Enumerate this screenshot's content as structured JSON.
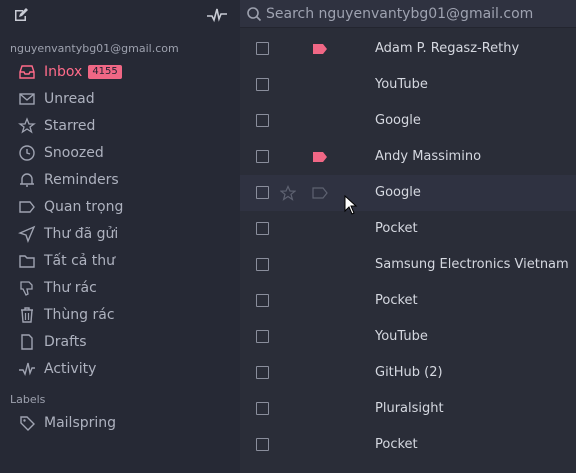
{
  "toolbar": {
    "compose_icon": "compose-icon",
    "activity_icon": "activity-icon"
  },
  "search": {
    "placeholder": "Search nguyenvantybg01@gmail.com"
  },
  "sidebar": {
    "account": "nguyenvantybg01@gmail.com",
    "items": [
      {
        "label": "Inbox",
        "icon": "inbox-icon",
        "badge": "4155",
        "active": true
      },
      {
        "label": "Unread",
        "icon": "envelope-icon"
      },
      {
        "label": "Starred",
        "icon": "star-icon"
      },
      {
        "label": "Snoozed",
        "icon": "clock-icon"
      },
      {
        "label": "Reminders",
        "icon": "bell-icon"
      },
      {
        "label": "Quan trọng",
        "icon": "tag-icon"
      },
      {
        "label": "Thư đã gửi",
        "icon": "send-icon"
      },
      {
        "label": "Tất cả thư",
        "icon": "folder-icon"
      },
      {
        "label": "Thư rác",
        "icon": "thumbs-down-icon"
      },
      {
        "label": "Thùng rác",
        "icon": "trash-icon"
      },
      {
        "label": "Drafts",
        "icon": "draft-icon"
      },
      {
        "label": "Activity",
        "icon": "activity-icon"
      }
    ],
    "labels_header": "Labels",
    "labels": [
      {
        "label": "Mailspring",
        "icon": "label-icon"
      }
    ]
  },
  "messages": [
    {
      "sender": "Adam P. Regasz-Rethy",
      "important": true
    },
    {
      "sender": "YouTube",
      "important": false
    },
    {
      "sender": "Google",
      "important": false
    },
    {
      "sender": "Andy Massimino",
      "important": true
    },
    {
      "sender": "Google",
      "important": false,
      "hover": true
    },
    {
      "sender": "Pocket",
      "important": false
    },
    {
      "sender": "Samsung Electronics Vietnam",
      "important": false
    },
    {
      "sender": "Pocket",
      "important": false
    },
    {
      "sender": "YouTube",
      "important": false
    },
    {
      "sender": "GitHub (2)",
      "important": false
    },
    {
      "sender": "Pluralsight",
      "important": false
    },
    {
      "sender": "Pocket",
      "important": false
    }
  ],
  "colors": {
    "accent": "#f06785",
    "sidebar_bg": "#262935",
    "list_bg": "#2a2d38"
  }
}
